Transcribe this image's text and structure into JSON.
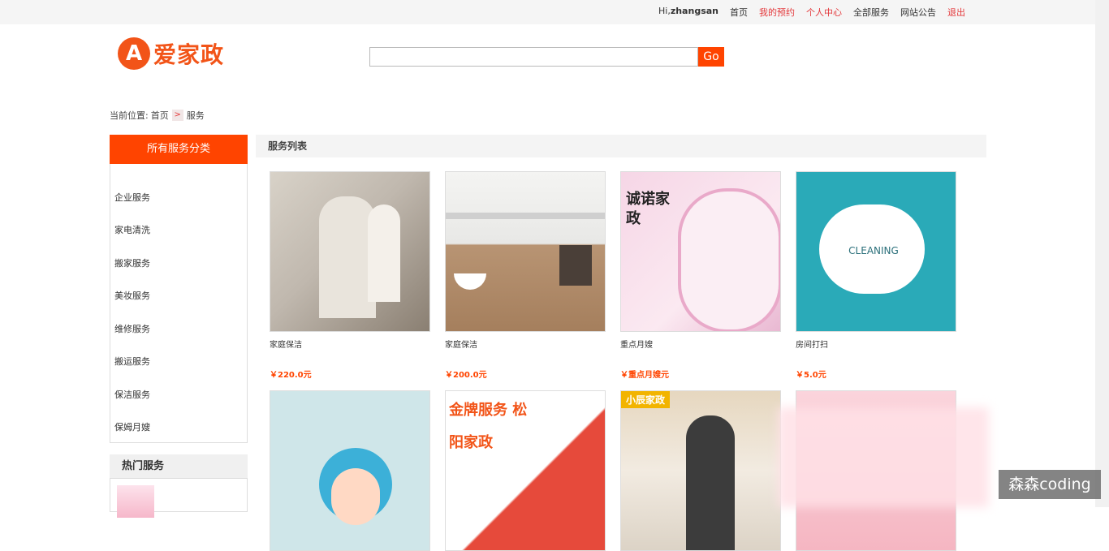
{
  "topbar": {
    "greeting_prefix": "Hi,",
    "username": "zhangsan",
    "links": [
      {
        "label": "首页",
        "highlight": false
      },
      {
        "label": "我的预约",
        "highlight": true
      },
      {
        "label": "个人中心",
        "highlight": true
      },
      {
        "label": "全部服务",
        "highlight": false
      },
      {
        "label": "网站公告",
        "highlight": false
      },
      {
        "label": "退出",
        "highlight": true
      }
    ]
  },
  "logo": {
    "mark": "A",
    "text": "爱家政"
  },
  "search": {
    "value": "",
    "button_label": "Go"
  },
  "breadcrumb": {
    "prefix": "当前位置:",
    "home": "首页",
    "separator": ">",
    "current": "服务"
  },
  "sidebar": {
    "header": "所有服务分类",
    "categories": [
      "企业服务",
      "家电清洗",
      "搬家服务",
      "美妆服务",
      "维修服务",
      "搬运服务",
      "保洁服务",
      "保姆月嫂"
    ],
    "hot_header": "热门服务"
  },
  "main": {
    "header": "服务列表",
    "services": [
      {
        "name": "家庭保洁",
        "price": "￥220.0元",
        "image_text": ""
      },
      {
        "name": "家庭保洁",
        "price": "￥200.0元",
        "image_text": ""
      },
      {
        "name": "重点月嫂",
        "price": "￥重点月嫂元",
        "image_text": "诚诺家政"
      },
      {
        "name": "房间打扫",
        "price": "￥5.0元",
        "image_text": "CLEANING"
      },
      {
        "name": "",
        "price": "",
        "image_text": ""
      },
      {
        "name": "",
        "price": "",
        "image_text": "金牌服务 松阳家政"
      },
      {
        "name": "",
        "price": "",
        "image_text": "小辰家政"
      },
      {
        "name": "",
        "price": "",
        "image_text": ""
      }
    ]
  },
  "watermark": "森森coding",
  "colors": {
    "accent": "#ff4400",
    "link_red": "#e4393c"
  }
}
